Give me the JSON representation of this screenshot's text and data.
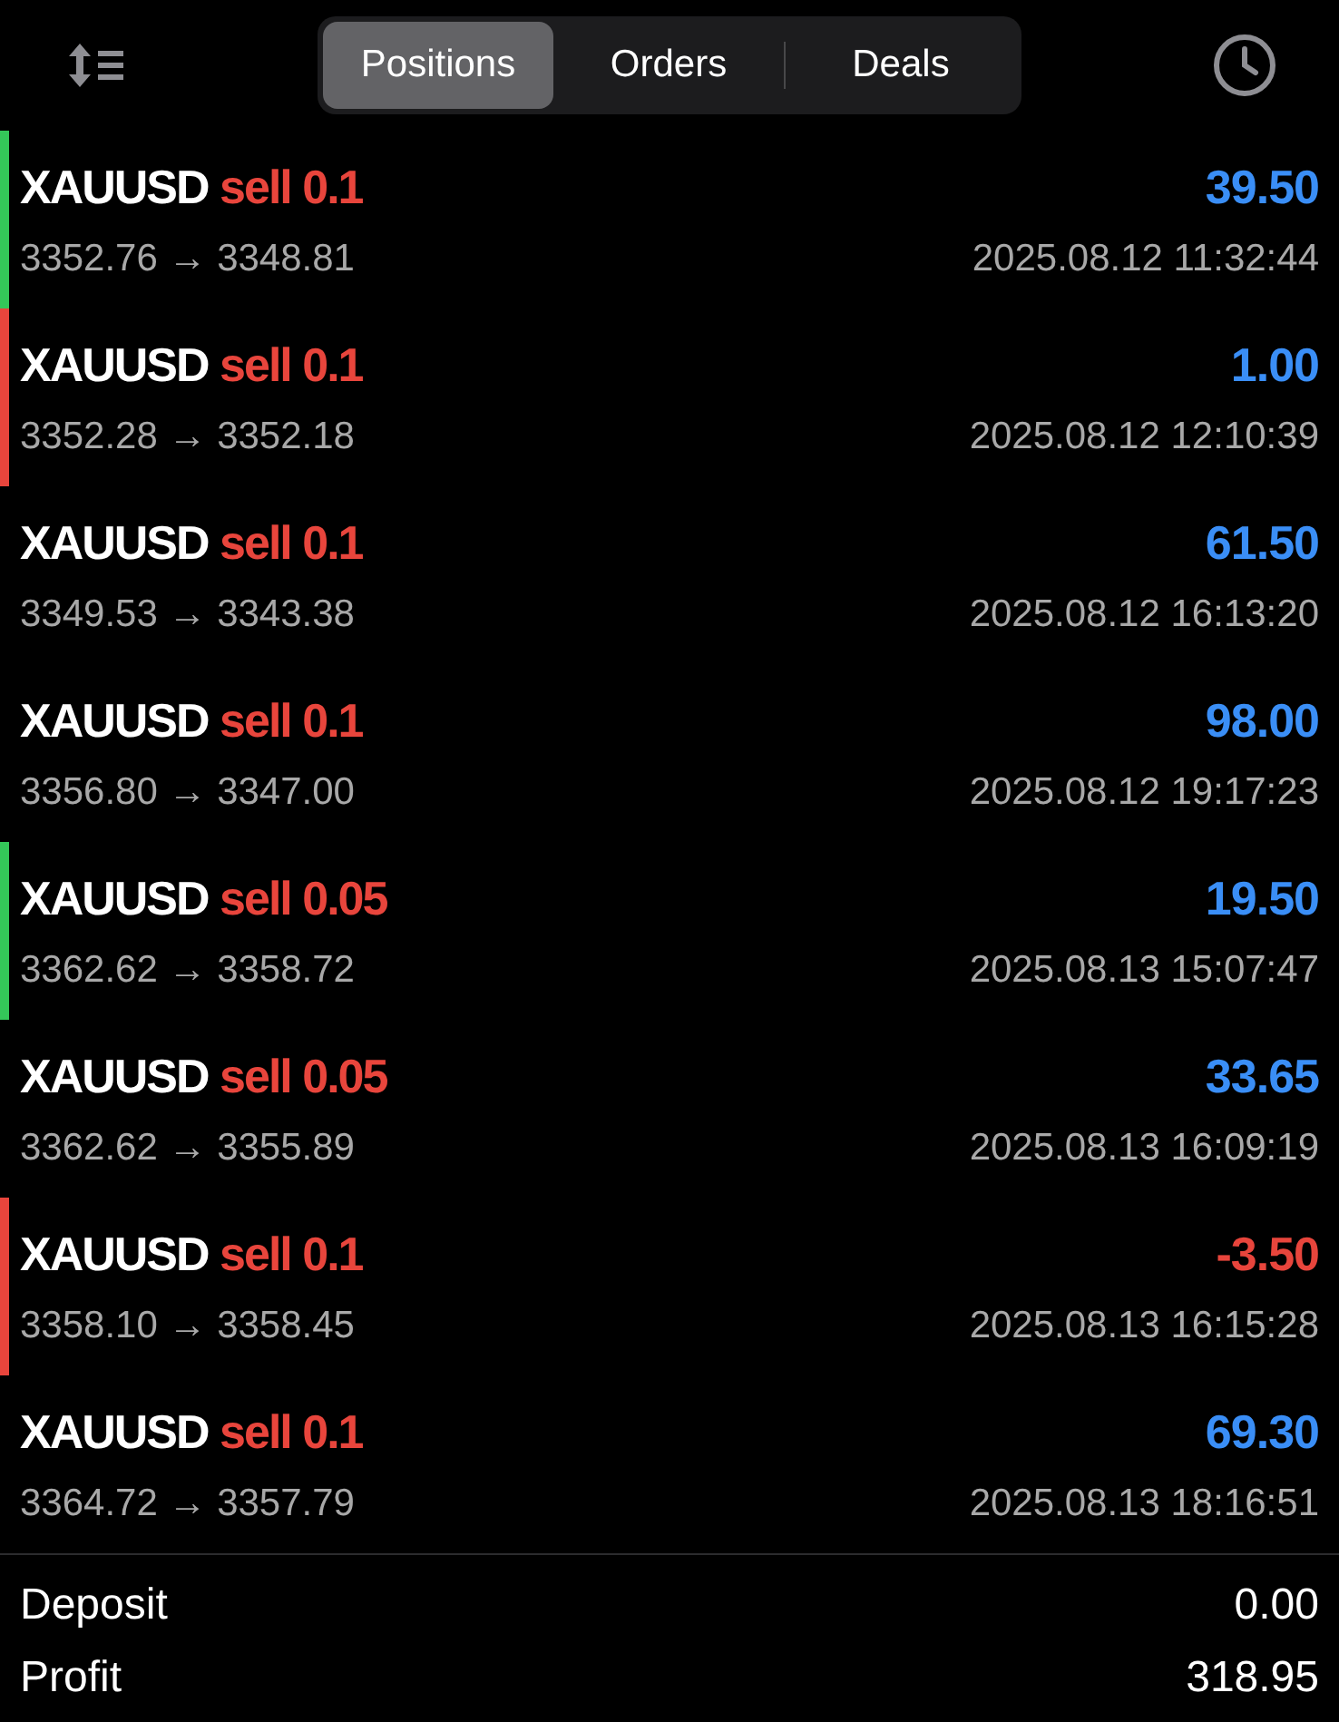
{
  "tabs": [
    {
      "label": "Positions",
      "selected": true
    },
    {
      "label": "Orders",
      "selected": false
    },
    {
      "label": "Deals",
      "selected": false
    }
  ],
  "deals": [
    {
      "symbol": "XAUUSD",
      "side": "sell 0.1",
      "prices": "3352.76 → 3348.81",
      "time": "2025.08.12 11:32:44",
      "profit": {
        "text": "39.50",
        "color": "#3a8ef6"
      },
      "marker": {
        "color": "#34c759"
      }
    },
    {
      "symbol": "XAUUSD",
      "side": "sell 0.1",
      "prices": "3352.28 → 3352.18",
      "time": "2025.08.12 12:10:39",
      "profit": {
        "text": "1.00",
        "color": "#3a8ef6"
      },
      "marker": {
        "color": "#e8453c"
      }
    },
    {
      "symbol": "XAUUSD",
      "side": "sell 0.1",
      "prices": "3349.53 → 3343.38",
      "time": "2025.08.12 16:13:20",
      "profit": {
        "text": "61.50",
        "color": "#3a8ef6"
      }
    },
    {
      "symbol": "XAUUSD",
      "side": "sell 0.1",
      "prices": "3356.80 → 3347.00",
      "time": "2025.08.12 19:17:23",
      "profit": {
        "text": "98.00",
        "color": "#3a8ef6"
      }
    },
    {
      "symbol": "XAUUSD",
      "side": "sell 0.05",
      "prices": "3362.62 → 3358.72",
      "time": "2025.08.13 15:07:47",
      "profit": {
        "text": "19.50",
        "color": "#3a8ef6"
      },
      "marker": {
        "color": "#34c759"
      }
    },
    {
      "symbol": "XAUUSD",
      "side": "sell 0.05",
      "prices": "3362.62 → 3355.89",
      "time": "2025.08.13 16:09:19",
      "profit": {
        "text": "33.65",
        "color": "#3a8ef6"
      }
    },
    {
      "symbol": "XAUUSD",
      "side": "sell 0.1",
      "prices": "3358.10 → 3358.45",
      "time": "2025.08.13 16:15:28",
      "profit": {
        "text": "-3.50",
        "color": "#e8453c"
      },
      "marker": {
        "color": "#e8453c"
      }
    },
    {
      "symbol": "XAUUSD",
      "side": "sell 0.1",
      "prices": "3364.72 → 3357.79",
      "time": "2025.08.13 18:16:51",
      "profit": {
        "text": "69.30",
        "color": "#3a8ef6"
      }
    }
  ],
  "summary": [
    {
      "label": "Deposit",
      "value": "0.00"
    },
    {
      "label": "Profit",
      "value": "318.95"
    }
  ]
}
